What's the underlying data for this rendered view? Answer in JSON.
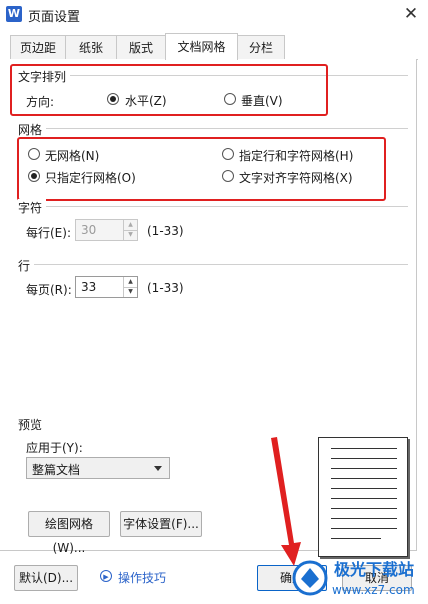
{
  "window": {
    "title": "页面设置",
    "icon": "W"
  },
  "tabs": [
    "页边距",
    "纸张",
    "版式",
    "文档网格",
    "分栏"
  ],
  "active_tab": "文档网格",
  "text_direction": {
    "heading": "文字排列",
    "label": "方向:",
    "options": [
      "水平(Z)",
      "垂直(V)"
    ],
    "selected": "水平(Z)"
  },
  "grid": {
    "heading": "网格",
    "options": [
      "无网格(N)",
      "只指定行网格(O)",
      "指定行和字符网格(H)",
      "文字对齐字符网格(X)"
    ],
    "selected": "只指定行网格(O)"
  },
  "chars": {
    "heading": "字符",
    "label": "每行(E):",
    "value": "30",
    "range": "(1-33)",
    "enabled": false
  },
  "lines": {
    "heading": "行",
    "label": "每页(R):",
    "value": "33",
    "range": "(1-33)",
    "enabled": true
  },
  "preview": {
    "heading": "预览",
    "apply_label": "应用于(Y):",
    "apply_value": "整篇文档"
  },
  "buttons": {
    "draw_grid": "绘图网格(W)...",
    "font_settings": "字体设置(F)...",
    "default": "默认(D)...",
    "ok": "确定",
    "cancel": "取消"
  },
  "help": {
    "label": "操作技巧"
  },
  "watermark": {
    "text": "极光下载站",
    "url": "www.xz7.com"
  },
  "colors": {
    "highlight_box": "#e02020",
    "arrow": "#e02020",
    "link": "#2b63c9"
  },
  "icons": [
    "app-logo-icon",
    "close-icon",
    "chevron-down-icon",
    "spin-up-icon",
    "spin-down-icon",
    "help-circle-icon"
  ]
}
